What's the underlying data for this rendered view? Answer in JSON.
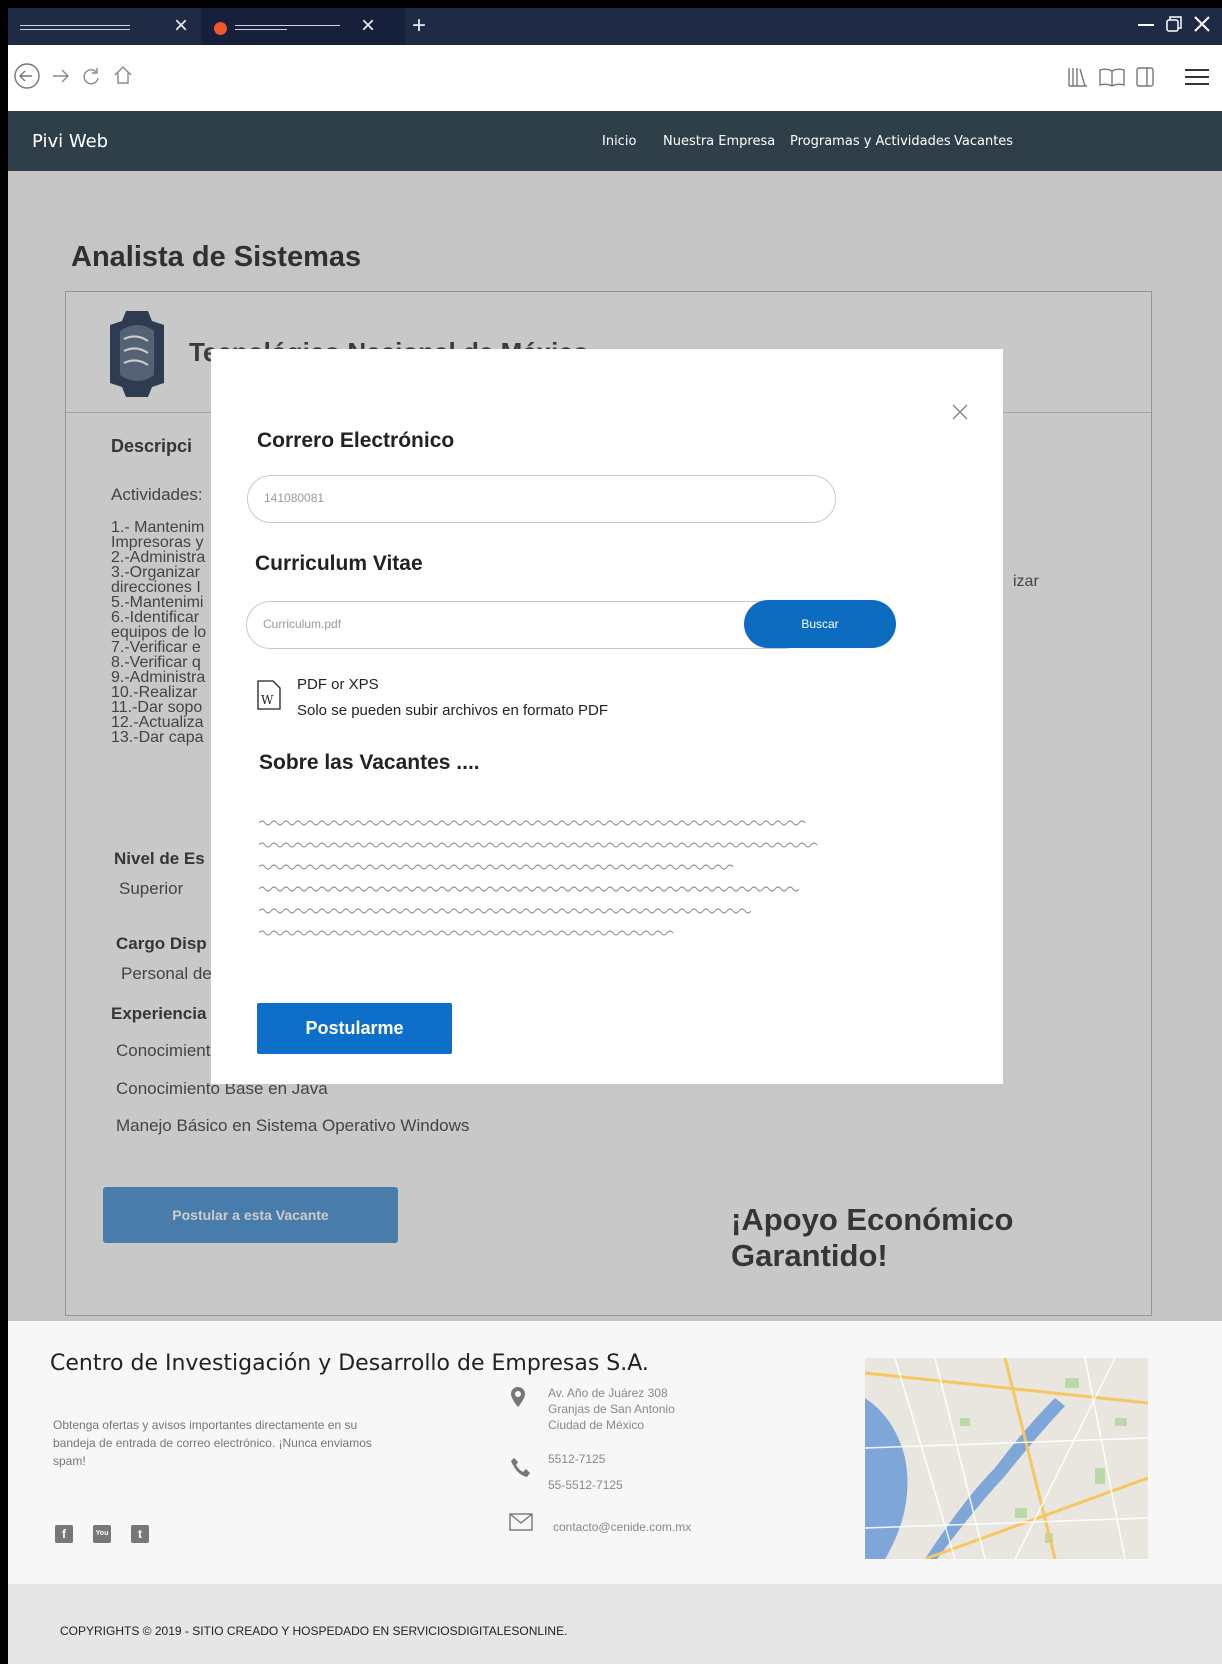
{
  "browser": {
    "tab2_close": "×",
    "tab1_close": "×",
    "new_tab": "+"
  },
  "site": {
    "brand": "Pivi Web",
    "menu": [
      "Inicio",
      "Nuestra Empresa",
      "Programas y Actividades",
      "Vacantes"
    ]
  },
  "job": {
    "title": "Analista de Sistemas",
    "company": "Tecnológico Nacional de México",
    "description_heading": "Descripci",
    "activities_label": "Actividades:",
    "activities": [
      "1.- Mantenim",
      "Impresoras y",
      "2.-Administra",
      "3.-Organizar",
      "direcciones I",
      "5.-Mantenimi",
      "6.-Identificar",
      "equipos de lo",
      "7.-Verificar e",
      "8.-Verificar q",
      "9.-Administra",
      "10.-Realizar",
      "11.-Dar sopo",
      "12.-Actualiza",
      "13.-Dar capa"
    ],
    "activity_right_fragment": "izar",
    "level_heading": "Nivel de Es",
    "level_value": "Superior",
    "cargo_heading": "Cargo Disp",
    "cargo_value": "Personal de",
    "experience_heading": "Experiencia",
    "experience": [
      "Conocimient",
      "Conocimiento Base en Java",
      "Manejo Básico en Sistema Operativo Windows"
    ],
    "post_button": "Postular a esta Vacante",
    "support": "¡Apoyo Económico Garantido!"
  },
  "modal": {
    "email_label": "Correro Electrónico",
    "email_value": "141080081",
    "cv_label": "Curriculum Vitae",
    "cv_value": "Curriculum.pdf",
    "browse_button": "Buscar",
    "file_type": "PDF or XPS",
    "file_note": "Solo se pueden subir archivos en formato PDF",
    "about_label": "Sobre las Vacantes ....",
    "apply_button": "Postularme",
    "close": "×"
  },
  "footer": {
    "title": "Centro de Investigación y Desarrollo de Empresas S.A.",
    "description": "Obtenga ofertas y avisos importantes directamente en su bandeja de entrada de correo electrónico. ¡Nunca enviamos spam!",
    "address": [
      "Av. Año de Juárez 308",
      "Granjas de San Antonio",
      "Ciudad de México"
    ],
    "phones": [
      "5512-7125",
      "55-5512-7125"
    ],
    "email": "contacto@cenide.com.mx",
    "copyright": "COPYRIGHTS © 2019 - SITIO CREADO Y HOSPEDADO EN SERVICIOSDIGITALESONLINE."
  },
  "icons": {
    "back": "back-icon",
    "forward": "forward-icon",
    "reload": "reload-icon",
    "home": "home-icon",
    "library": "library-icon",
    "reader": "reader-icon",
    "sidebar": "sidebar-icon",
    "menu": "hamburger-icon"
  },
  "colors": {
    "header": "#2f3f49",
    "tabbar": "#1f2a44",
    "accent": "#0d6cc0",
    "post_button": "#5b9bd5"
  }
}
